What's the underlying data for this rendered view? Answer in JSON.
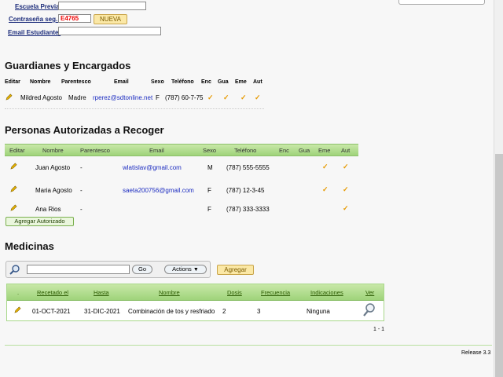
{
  "top_form": {
    "escuela_previa_label": "Escuela Previa",
    "escuela_previa_value": "",
    "contrasena_label": "Contraseña seg.:",
    "contrasena_value": "E4765",
    "nueva_button": "NUEVA",
    "email_estudiante_label": "Email Estudiante:",
    "email_estudiante_value": ""
  },
  "guardianes": {
    "title": "Guardianes y Encargados",
    "headers": [
      "Editar",
      "Nombre",
      "Parentesco",
      "Email",
      "Sexo",
      "Teléfono",
      "Enc",
      "Gua",
      "Eme",
      "Aut"
    ],
    "rows": [
      {
        "nombre": "Mildred Agosto",
        "parentesco": "Madre",
        "email": "rperez@sdtonline.net",
        "sexo": "F",
        "telefono": "(787) 60-7-75",
        "enc": "✓",
        "gua": "✓",
        "eme": "✓",
        "aut": "✓"
      }
    ]
  },
  "autorizadas": {
    "title": "Personas Autorizadas a Recoger",
    "headers": [
      "Editar",
      "Nombre",
      "Parentesco",
      "Email",
      "Sexo",
      "Teléfono",
      "Enc",
      "Gua",
      "Eme",
      "Aut"
    ],
    "rows": [
      {
        "nombre": "Juan Agosto",
        "parentesco": "-",
        "email": "wlatislav@gmail.com",
        "sexo": "M",
        "telefono": "(787) 555-5555",
        "eme": "✓",
        "aut": "✓"
      },
      {
        "nombre": "Maria Agosto",
        "parentesco": "-",
        "email": "saeta200756@gmail.com",
        "sexo": "F",
        "telefono": "(787) 12-3-45",
        "eme": "✓",
        "aut": "✓"
      },
      {
        "nombre": "Ana Rios",
        "parentesco": "-",
        "email": "",
        "sexo": "F",
        "telefono": "(787) 333-3333",
        "eme": "",
        "aut": "✓"
      }
    ],
    "add_button": "Agregar Autorizado"
  },
  "medicinas": {
    "title": "Medicinas",
    "search_value": "",
    "go_button": "Go",
    "actions_button": "Actions",
    "agregar_button": "Agregar",
    "headers": [
      ".",
      "Recetado el",
      "Hasta",
      "Nombre",
      "Dosis",
      "Frecuencia",
      "Indicaciones",
      "Ver"
    ],
    "rows": [
      {
        "recetado": "01-OCT-2021",
        "hasta": "31-DIC-2021",
        "nombre": "Combinación de tos y resfriado",
        "dosis": "2",
        "frecuencia": "3",
        "indicaciones": "Ninguna"
      }
    ],
    "pagination": "1 - 1"
  },
  "footer": {
    "release": "Release 3.3"
  },
  "colors": {
    "accent_green": "#9fd37a",
    "check_orange": "#e69a00",
    "link_blue": "#1b2bc0",
    "code_red": "#e00000"
  }
}
